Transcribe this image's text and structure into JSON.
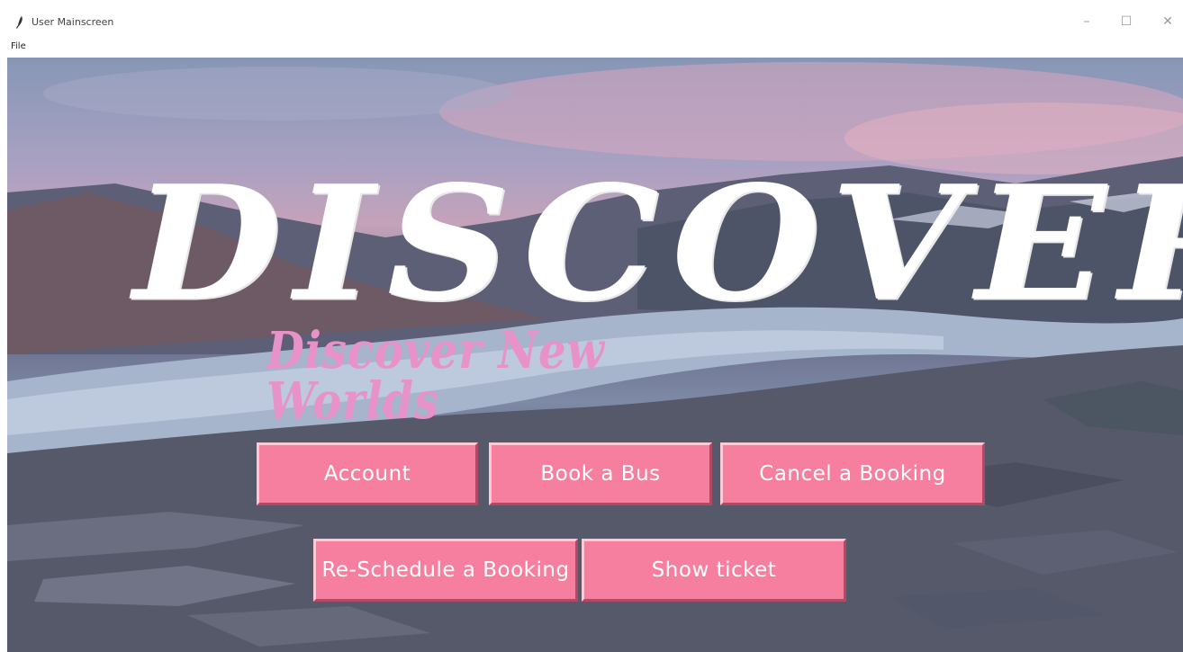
{
  "window": {
    "title": "User Mainscreen",
    "controls": {
      "minimize": "–",
      "maximize": "☐",
      "close": "✕"
    }
  },
  "menubar": {
    "items": [
      "File"
    ]
  },
  "hero": {
    "headline": "DISCOVER",
    "tagline": "Discover New Worlds",
    "headline_color": "#ffffff",
    "tagline_color": "#e792c9"
  },
  "buttons": {
    "account": "Account",
    "book_bus": "Book a Bus",
    "cancel_booking": "Cancel a Booking",
    "reschedule_booking": "Re-Schedule a Booking",
    "show_ticket": "Show ticket",
    "color": "#f67e9e"
  },
  "icons": [
    "feather-icon",
    "minimize-icon",
    "maximize-icon",
    "close-icon"
  ]
}
